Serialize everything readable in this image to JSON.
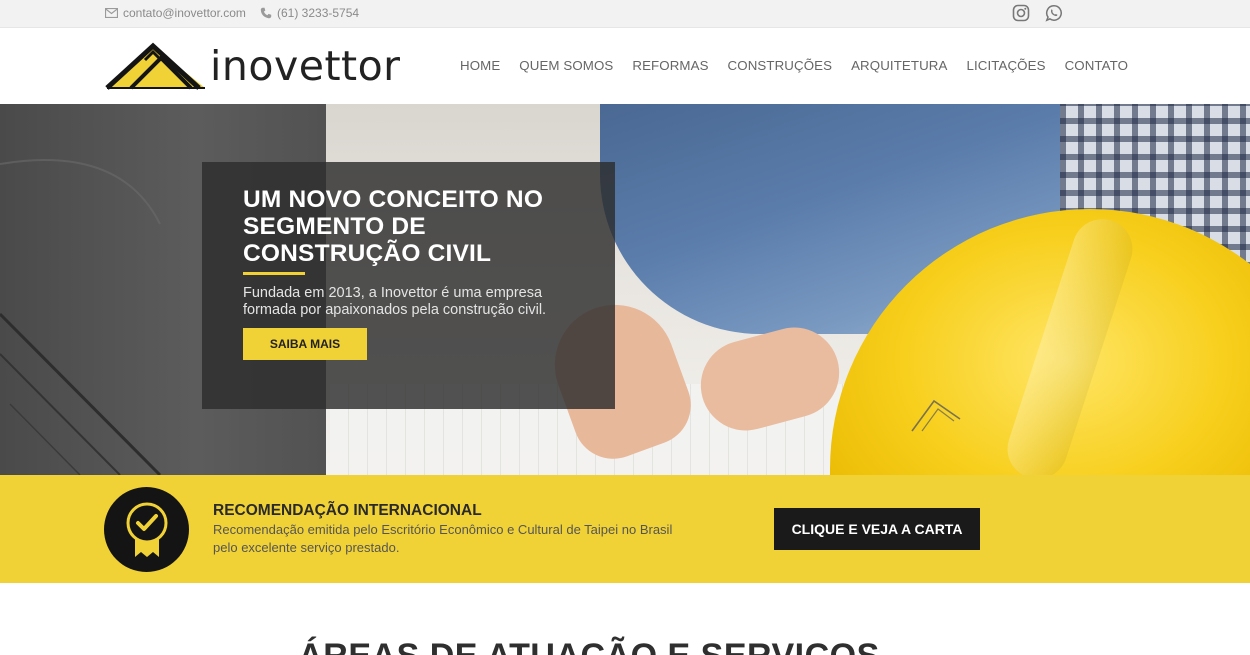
{
  "topbar": {
    "email": "contato@inovettor.com",
    "phone": "(61) 3233-5754",
    "icons": [
      "envelope-icon",
      "phone-icon",
      "instagram-icon",
      "whatsapp-icon"
    ]
  },
  "brand": {
    "name": "inovettor",
    "accent_color": "#f1d236",
    "dark_color": "#1a1a1a"
  },
  "nav": {
    "items": [
      {
        "label": "HOME"
      },
      {
        "label": "QUEM SOMOS"
      },
      {
        "label": "REFORMAS"
      },
      {
        "label": "CONSTRUÇÕES"
      },
      {
        "label": "ARQUITETURA"
      },
      {
        "label": "LICITAÇÕES"
      },
      {
        "label": "CONTATO"
      }
    ]
  },
  "hero": {
    "title": "UM NOVO CONCEITO NO SEGMENTO DE CONSTRUÇÃO CIVIL",
    "lead": "Fundada em 2013, a Inovettor é uma empresa formada por apaixonados pela construção civil.",
    "button": "SAIBA MAIS"
  },
  "recommendation": {
    "title": "RECOMENDAÇÃO INTERNACIONAL",
    "description": "Recomendação emitida pelo Escritório Econômico e Cultural de Taipei no Brasil pelo excelente serviço prestado.",
    "button": "CLIQUE E VEJA A CARTA"
  },
  "areas": {
    "heading": "ÁREAS DE ATUAÇÃO E SERVIÇOS"
  }
}
